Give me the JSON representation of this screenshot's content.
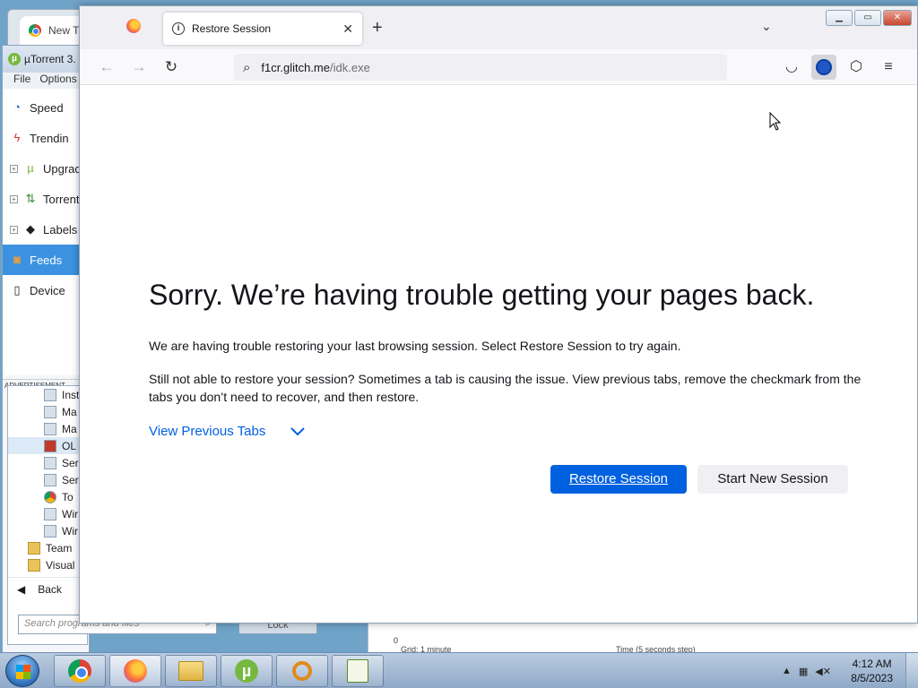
{
  "background": {
    "chrome_tab_label": "New T",
    "utorrent_title": "µTorrent 3.",
    "utorrent_menu": [
      "File",
      "Options"
    ],
    "utorrent_sidebar": [
      {
        "label": "Speed",
        "icon": "speed-icon"
      },
      {
        "label": "Trendin",
        "icon": "lightning-icon"
      },
      {
        "label": "Upgrad",
        "icon": "utorrent-icon"
      },
      {
        "label": "Torrent",
        "icon": "arrows-icon"
      },
      {
        "label": "Labels",
        "icon": "tag-icon"
      },
      {
        "label": "Feeds",
        "icon": "rss-icon"
      },
      {
        "label": "Device",
        "icon": "device-icon"
      }
    ],
    "advertisement_label": "ADVERTISEMENT",
    "start_menu_items": [
      "Inst",
      "Ma",
      "Ma",
      "OL",
      "Ser",
      "Ser",
      "To",
      "Wir",
      "Wir"
    ],
    "start_menu_folders": [
      "Team",
      "Visual"
    ],
    "start_menu_back": "Back",
    "search_placeholder": "Search programs and files",
    "lock_label": "Lock",
    "graph_zero": "0",
    "graph_grid_label": "Grid: 1 minute",
    "graph_time_label": "Time (5 seconds step)"
  },
  "firefox": {
    "tab_title": "Restore Session",
    "url_host": "f1cr.glitch.me",
    "url_path": "/idk.exe",
    "error": {
      "title": "Sorry. We’re having trouble getting your pages back.",
      "paragraph1": "We are having trouble restoring your last browsing session. Select Restore Session to try again.",
      "paragraph2": "Still not able to restore your session? Sometimes a tab is causing the issue. View previous tabs, remove the checkmark from the tabs you don’t need to recover, and then restore.",
      "view_previous_tabs": "View Previous Tabs",
      "restore_button": "Restore Session",
      "new_session_button": "Start New Session"
    },
    "accent_color": "#0061e0"
  },
  "taskbar": {
    "apps": [
      "chrome-icon",
      "firefox-icon",
      "folder-icon",
      "utorrent-icon",
      "search-icon",
      "chart-icon"
    ],
    "time": "4:12 AM",
    "date": "8/5/2023"
  }
}
